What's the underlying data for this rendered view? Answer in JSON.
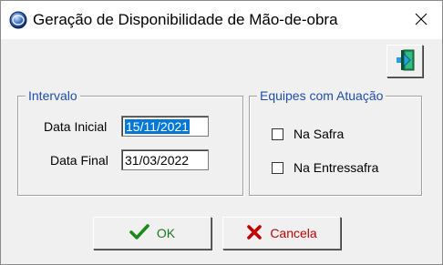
{
  "window": {
    "title": "Geração de Disponibilidade de Mão-de-obra"
  },
  "intervalo": {
    "legend": "Intervalo",
    "data_inicial_label": "Data Inicial",
    "data_inicial_value": "15/11/2021",
    "data_final_label": "Data Final",
    "data_final_value": "31/03/2022"
  },
  "equipes": {
    "legend": "Equipes com Atuação",
    "options": [
      {
        "label": "Na Safra",
        "checked": false
      },
      {
        "label": "Na Entressafra",
        "checked": false
      }
    ]
  },
  "buttons": {
    "ok_label": "OK",
    "cancel_label": "Cancela"
  },
  "colors": {
    "legend_text": "#1e4ea8",
    "selection": "#0078d7",
    "ok_green": "#1a7a1a",
    "cancel_red": "#c00000"
  }
}
